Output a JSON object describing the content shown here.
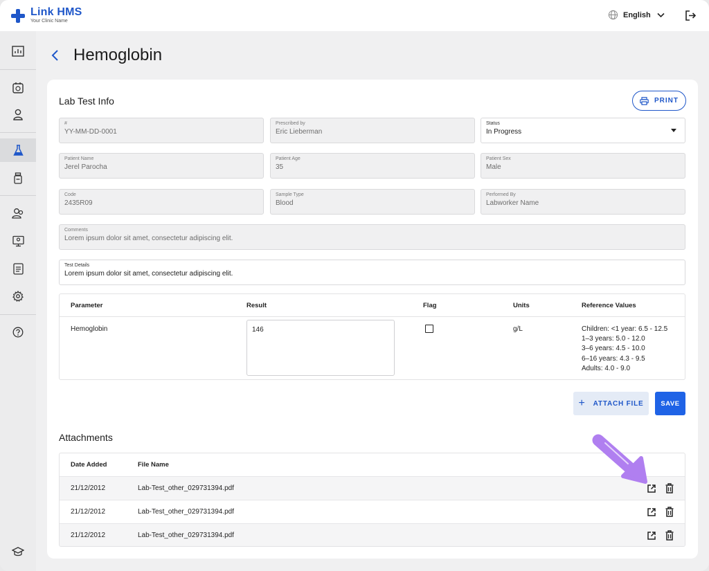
{
  "app": {
    "name": "Link HMS",
    "clinic": "Your Clinic Name"
  },
  "header": {
    "language": "English",
    "icons": [
      "globe-icon",
      "chevron-down-icon",
      "logout-icon"
    ]
  },
  "sidebar": {
    "icons": [
      "dashboard-icon",
      "appointments-icon",
      "patient-icon",
      "lab-icon",
      "medication-icon",
      "users-icon",
      "monitor-icon",
      "reports-icon",
      "settings-icon",
      "help-icon",
      "education-icon"
    ],
    "active": "lab-icon"
  },
  "page": {
    "title": "Hemoglobin"
  },
  "lab_info": {
    "section_title": "Lab Test Info",
    "print_label": "PRINT",
    "fields": {
      "number": {
        "label": "#",
        "value": "YY-MM-DD-0001"
      },
      "prescribed_by": {
        "label": "Prescribed by",
        "value": "Eric Lieberman"
      },
      "status": {
        "label": "Status",
        "value": "In Progress"
      },
      "patient_name": {
        "label": "Patient Name",
        "value": "Jerel Parocha"
      },
      "patient_age": {
        "label": "Patient Age",
        "value": "35"
      },
      "patient_sex": {
        "label": "Patient Sex",
        "value": "Male"
      },
      "code": {
        "label": "Code",
        "value": "2435R09"
      },
      "sample_type": {
        "label": "Sample Type",
        "value": "Blood"
      },
      "performed_by": {
        "label": "Performed By",
        "value": "Labworker Name"
      },
      "comments": {
        "label": "Comments",
        "value": "Lorem ipsum dolor sit amet, consectetur adipiscing elit."
      },
      "test_details": {
        "label": "Test Details",
        "value": "Lorem ipsum dolor sit amet, consectetur adipiscing elit."
      }
    }
  },
  "results_table": {
    "headers": [
      "Parameter",
      "Result",
      "Flag",
      "Units",
      "Reference Values"
    ],
    "row": {
      "parameter": "Hemoglobin",
      "result": "146",
      "flag": false,
      "units": "g/L",
      "reference": [
        "Children: <1 year: 6.5 - 12.5",
        "1–3 years: 5.0 - 12.0",
        "3–6 years: 4.5 - 10.0",
        "6–16 years: 4.3 - 9.5",
        "Adults: 4.0 - 9.0"
      ]
    }
  },
  "actions": {
    "attach_label": "ATTACH FILE",
    "save_label": "SAVE"
  },
  "attachments": {
    "section_title": "Attachments",
    "headers": [
      "Date Added",
      "File Name"
    ],
    "rows": [
      {
        "date": "21/12/2012",
        "file": "Lab-Test_other_029731394.pdf"
      },
      {
        "date": "21/12/2012",
        "file": "Lab-Test_other_029731394.pdf"
      },
      {
        "date": "21/12/2012",
        "file": "Lab-Test_other_029731394.pdf"
      }
    ]
  },
  "colors": {
    "brand": "#1f57c9",
    "primary_button": "#1f63e6",
    "highlight_arrow": "#b07ff0"
  }
}
